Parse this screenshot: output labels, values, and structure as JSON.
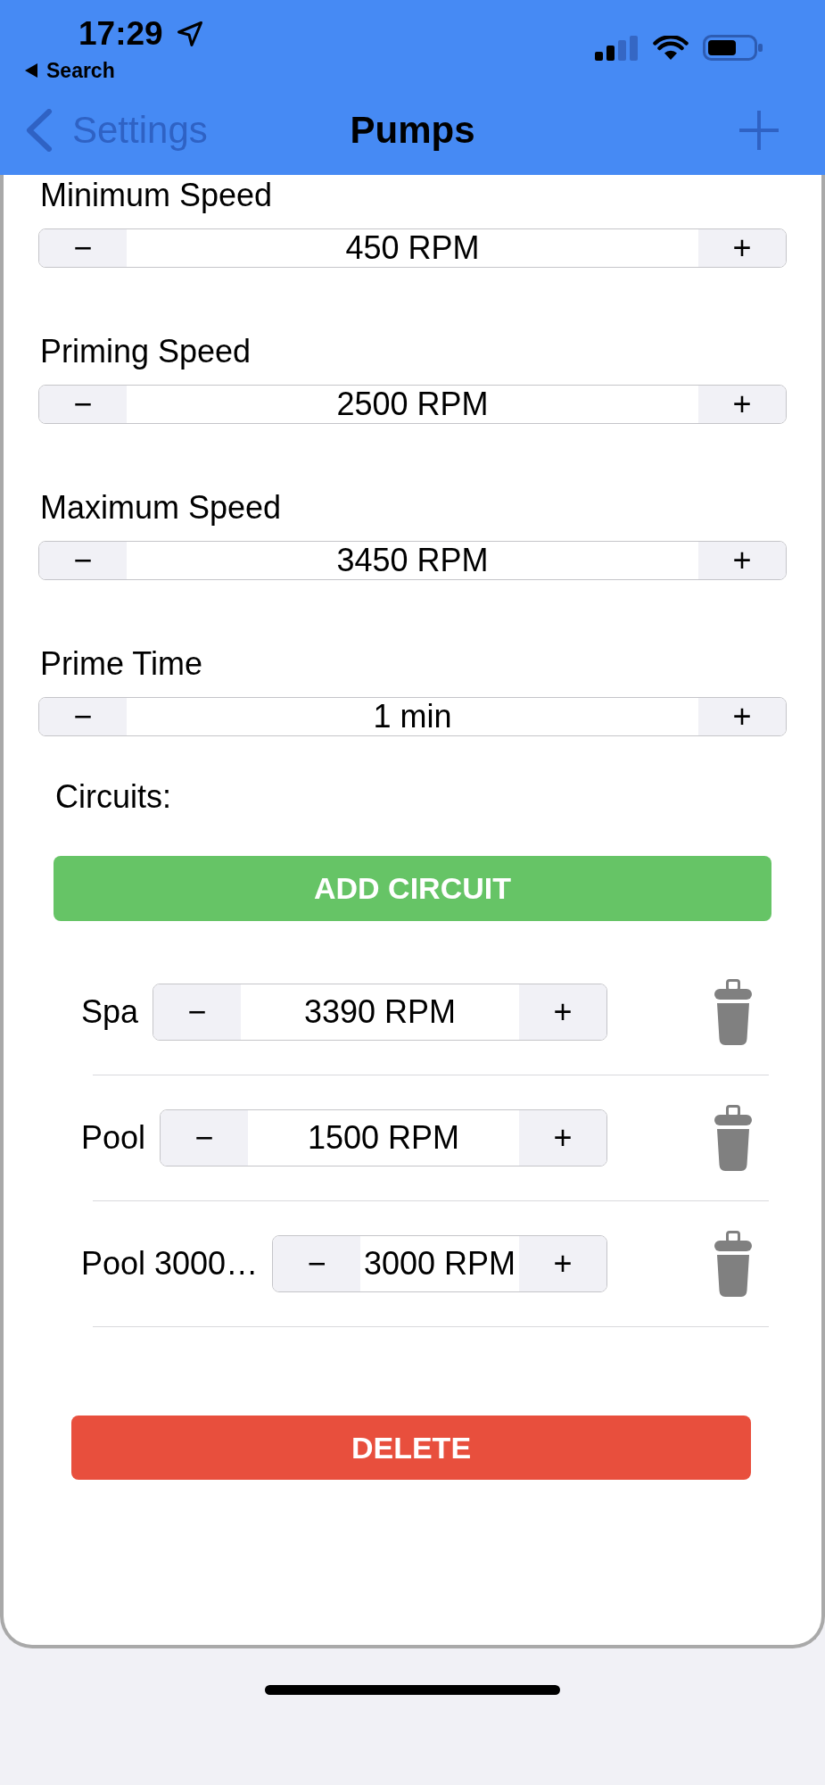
{
  "status_bar": {
    "time": "17:29",
    "back_link": "Search"
  },
  "nav_bar": {
    "back_label": "Settings",
    "title": "Pumps"
  },
  "speed_settings": [
    {
      "label": "Minimum Speed",
      "minus": "−",
      "value": "450 RPM",
      "plus": "+"
    },
    {
      "label": "Priming Speed",
      "minus": "−",
      "value": "2500 RPM",
      "plus": "+"
    },
    {
      "label": "Maximum Speed",
      "minus": "−",
      "value": "3450 RPM",
      "plus": "+"
    },
    {
      "label": "Prime Time",
      "minus": "−",
      "value": "1 min",
      "plus": "+"
    }
  ],
  "circuits": {
    "heading": "Circuits:",
    "add_button": "ADD CIRCUIT",
    "items": [
      {
        "name": "Spa",
        "minus": "−",
        "value": "3390 RPM",
        "plus": "+"
      },
      {
        "name": "Pool",
        "minus": "−",
        "value": "1500 RPM",
        "plus": "+"
      },
      {
        "name": "Pool 3000…",
        "minus": "−",
        "value": "3000 RPM",
        "plus": "+"
      }
    ]
  },
  "delete_button": "DELETE"
}
